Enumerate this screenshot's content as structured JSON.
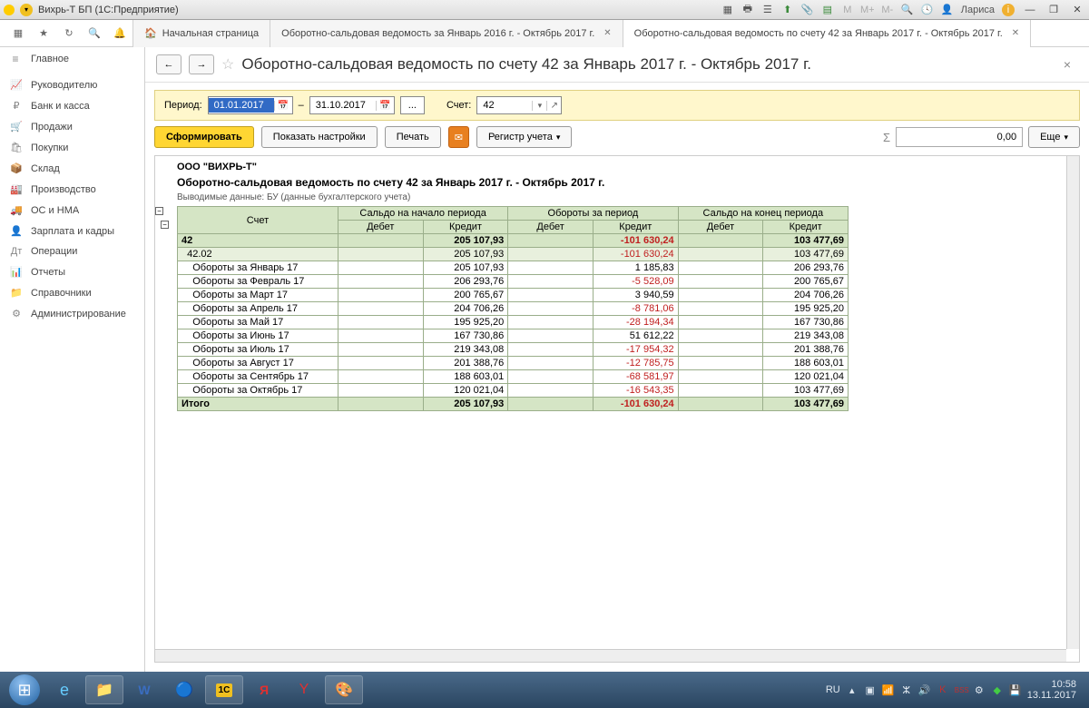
{
  "window": {
    "title": "Вихрь-Т БП  (1С:Предприятие)",
    "user": "Лариса"
  },
  "toolbar_m": [
    "М",
    "М+",
    "М-"
  ],
  "tabs": [
    {
      "label": "Начальная страница",
      "home": true
    },
    {
      "label": "Оборотно-сальдовая ведомость за Январь 2016 г. - Октябрь 2017 г."
    },
    {
      "label": "Оборотно-сальдовая ведомость по счету 42 за Январь 2017 г. - Октябрь 2017 г.",
      "active": true
    }
  ],
  "sidebar": {
    "header": "Главное",
    "items": [
      {
        "icon": "📈",
        "label": "Руководителю"
      },
      {
        "icon": "₽",
        "label": "Банк и касса"
      },
      {
        "icon": "🛒",
        "label": "Продажи"
      },
      {
        "icon": "🛍",
        "label": "Покупки"
      },
      {
        "icon": "📦",
        "label": "Склад"
      },
      {
        "icon": "🏭",
        "label": "Производство"
      },
      {
        "icon": "🚚",
        "label": "ОС и НМА"
      },
      {
        "icon": "👤",
        "label": "Зарплата и кадры"
      },
      {
        "icon": "Дт",
        "label": "Операции"
      },
      {
        "icon": "📊",
        "label": "Отчеты"
      },
      {
        "icon": "📁",
        "label": "Справочники"
      },
      {
        "icon": "⚙",
        "label": "Администрирование"
      }
    ]
  },
  "page": {
    "title": "Оборотно-сальдовая ведомость по счету 42 за Январь 2017 г. - Октябрь 2017 г."
  },
  "filter": {
    "period_label": "Период:",
    "date_from": "01.01.2017",
    "date_to": "31.10.2017",
    "account_label": "Счет:",
    "account": "42"
  },
  "actions": {
    "form": "Сформировать",
    "settings": "Показать настройки",
    "print": "Печать",
    "register": "Регистр учета",
    "more": "Еще",
    "sum": "0,00"
  },
  "report": {
    "company": "ООО \"ВИХРЬ-Т\"",
    "title": "Оборотно-сальдовая ведомость по счету 42 за Январь 2017 г. - Октябрь 2017 г.",
    "subtitle": "Выводимые данные: БУ (данные бухгалтерского учета)",
    "headers": {
      "acc": "Счет",
      "opening": "Сальдо на начало периода",
      "turnover": "Обороты за период",
      "closing": "Сальдо на конец периода",
      "debit": "Дебет",
      "credit": "Кредит"
    },
    "rows": [
      {
        "kind": "green",
        "acc": "42",
        "oc": "205 107,93",
        "tc": "-101 630,24",
        "cc": "103 477,69"
      },
      {
        "kind": "sub",
        "acc": "42.02",
        "oc": "205 107,93",
        "tc": "-101 630,24",
        "cc": "103 477,69"
      },
      {
        "kind": "data",
        "acc": "Обороты за Январь 17",
        "oc": "205 107,93",
        "tc": "1 185,83",
        "cc": "206 293,76"
      },
      {
        "kind": "data",
        "acc": "Обороты за Февраль 17",
        "oc": "206 293,76",
        "tc": "-5 528,09",
        "cc": "200 765,67"
      },
      {
        "kind": "data",
        "acc": "Обороты за Март 17",
        "oc": "200 765,67",
        "tc": "3 940,59",
        "cc": "204 706,26"
      },
      {
        "kind": "data",
        "acc": "Обороты за Апрель 17",
        "oc": "204 706,26",
        "tc": "-8 781,06",
        "cc": "195 925,20"
      },
      {
        "kind": "data",
        "acc": "Обороты за Май 17",
        "oc": "195 925,20",
        "tc": "-28 194,34",
        "cc": "167 730,86"
      },
      {
        "kind": "data",
        "acc": "Обороты за Июнь 17",
        "oc": "167 730,86",
        "tc": "51 612,22",
        "cc": "219 343,08"
      },
      {
        "kind": "data",
        "acc": "Обороты за Июль 17",
        "oc": "219 343,08",
        "tc": "-17 954,32",
        "cc": "201 388,76"
      },
      {
        "kind": "data",
        "acc": "Обороты за Август 17",
        "oc": "201 388,76",
        "tc": "-12 785,75",
        "cc": "188 603,01"
      },
      {
        "kind": "data",
        "acc": "Обороты за Сентябрь 17",
        "oc": "188 603,01",
        "tc": "-68 581,97",
        "cc": "120 021,04"
      },
      {
        "kind": "data",
        "acc": "Обороты за Октябрь 17",
        "oc": "120 021,04",
        "tc": "-16 543,35",
        "cc": "103 477,69"
      },
      {
        "kind": "total",
        "acc": "Итого",
        "oc": "205 107,93",
        "tc": "-101 630,24",
        "cc": "103 477,69"
      }
    ]
  },
  "taskbar": {
    "lang": "RU",
    "time": "10:58",
    "date": "13.11.2017"
  }
}
